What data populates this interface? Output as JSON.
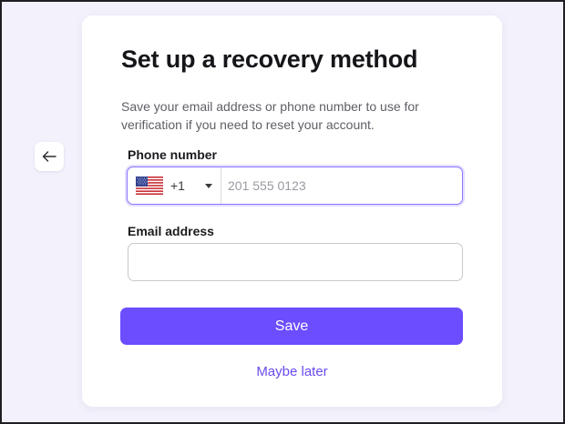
{
  "page": {
    "back_icon": "arrow-left-icon"
  },
  "form": {
    "title": "Set up a recovery method",
    "description": "Save your email address or phone number to use for verification if you need to reset your account.",
    "phone": {
      "label": "Phone number",
      "country_flag": "us-flag-icon",
      "dial_code": "+1",
      "dropdown_icon": "chevron-down-icon",
      "value": "",
      "placeholder": "201 555 0123"
    },
    "email": {
      "label": "Email address",
      "value": "",
      "placeholder": ""
    },
    "save_label": "Save",
    "later_label": "Maybe later"
  },
  "colors": {
    "accent": "#6c4dff",
    "link": "#6a4cf0",
    "focus_border": "#8b77ff",
    "background": "#f3f1fb"
  }
}
